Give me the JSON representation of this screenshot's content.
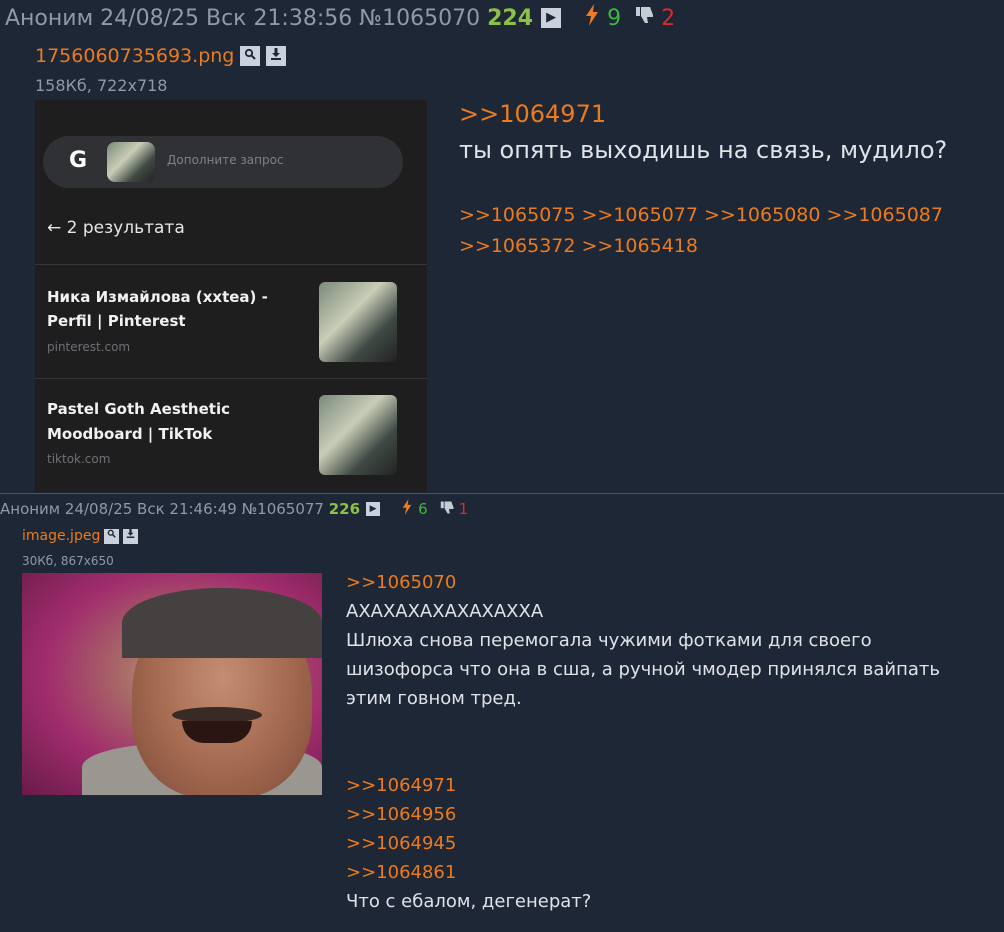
{
  "posts": [
    {
      "author": "Аноним",
      "datetime": "24/08/25 Вск 21:38:56",
      "number": "№1065070",
      "count": "224",
      "play_icon": "▶",
      "bolt_icon": "ϟ",
      "likes": "9",
      "dislike_icon": "thumb-down",
      "dislikes": "2",
      "file_name": "1756060735693.png",
      "file_meta": "158Кб, 722x718",
      "message_lines": [
        ">>1064971",
        "ты опять выходишь на связь, мудило?"
      ],
      "replies": ">>1065075 >>1065077 >>1065080 >>1065087 >>1065372 >>1065418",
      "image": {
        "search_letter": "G",
        "search_placeholder": "Дополните запрос",
        "back_label": "←  2 результата",
        "results": [
          {
            "title1": "Ника Измайлова (xxtea) -",
            "title2": "Perfil | Pinterest",
            "site": "pinterest.com"
          },
          {
            "title1": "Pastel Goth Aesthetic",
            "title2": "Moodboard | TikTok",
            "site": "tiktok.com"
          }
        ]
      }
    },
    {
      "author": "Аноним",
      "datetime": "24/08/25 Вск 21:46:49",
      "number": "№1065077",
      "count": "226",
      "play_icon": "▶",
      "bolt_icon": "ϟ",
      "likes": "6",
      "dislike_icon": "thumb-down",
      "dislikes": "1",
      "file_name": "image.jpeg",
      "file_meta": "30Кб, 867x650",
      "message_lines": [
        ">>1065070",
        "АХАХАХАХАХАХАХХА",
        "Шлюха снова перемогала чужими фотками для своего",
        "шизофорса что она в сша, а ручной чмодер принялся вайпать",
        "этим говном тред.",
        "",
        "",
        ">>1064971",
        ">>1064956",
        ">>1064945",
        ">>1064861",
        "Что с ебалом, дегенерат?"
      ]
    }
  ]
}
